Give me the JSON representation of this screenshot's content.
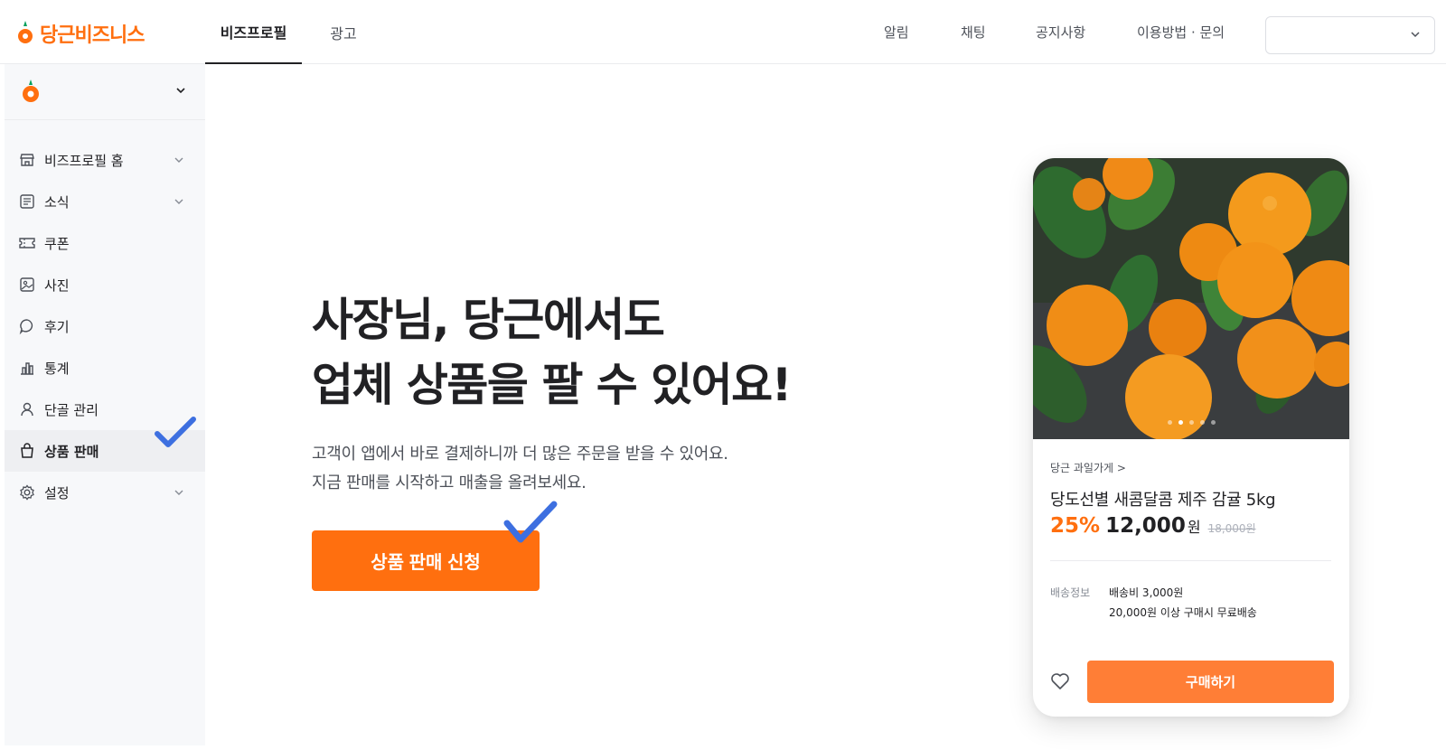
{
  "brand": {
    "name": "당근비즈니스",
    "accent": "#ff6f0f"
  },
  "header": {
    "tabs": [
      {
        "label": "비즈프로필",
        "active": true
      },
      {
        "label": "광고",
        "active": false
      }
    ],
    "nav": {
      "alarm": "알림",
      "chat": "채팅",
      "notice": "공지사항",
      "guide": "이용방법 · 문의"
    },
    "account_select": {
      "value": "",
      "icon": "chevron-down-icon"
    }
  },
  "sidebar": {
    "store_switch": {
      "icon": "carrot-icon"
    },
    "items": [
      {
        "label": "비즈프로필 홈",
        "icon": "store-icon",
        "expandable": true
      },
      {
        "label": "소식",
        "icon": "news-icon",
        "expandable": true
      },
      {
        "label": "쿠폰",
        "icon": "coupon-icon",
        "expandable": false
      },
      {
        "label": "사진",
        "icon": "photo-icon",
        "expandable": false
      },
      {
        "label": "후기",
        "icon": "review-icon",
        "expandable": false
      },
      {
        "label": "통계",
        "icon": "stats-icon",
        "expandable": false
      },
      {
        "label": "단골 관리",
        "icon": "customer-icon",
        "expandable": false
      },
      {
        "label": "상품 판매",
        "icon": "bag-icon",
        "expandable": false,
        "active": true
      },
      {
        "label": "설정",
        "icon": "gear-icon",
        "expandable": true
      }
    ]
  },
  "hero": {
    "title_line1": "사장님, 당근에서도",
    "title_line2": "업체 상품을 팔 수 있어요!",
    "desc_line1": "고객이 앱에서 바로 결제하니까 더 많은 주문을 받을 수 있어요.",
    "desc_line2": "지금 판매를 시작하고 매출을 올려보세요.",
    "cta_label": "상품 판매 신청"
  },
  "product_card": {
    "image": "mandarin-oranges-photo",
    "carousel_dots": 5,
    "carousel_active": 1,
    "shop_link": "당근 과일가게 >",
    "name": "당도선별 새콤달콤 제주 감귤 5kg",
    "discount": "25%",
    "price": "12,000",
    "currency": "원",
    "original_price": "18,000원",
    "shipping_label": "배송정보",
    "shipping_fee": "배송비 3,000원",
    "free_shipping": "20,000원 이상 구매시 무료배송",
    "like_icon": "heart-icon",
    "buy_label": "구매하기"
  },
  "annotations": {
    "check_color": "#3d6fe0"
  }
}
